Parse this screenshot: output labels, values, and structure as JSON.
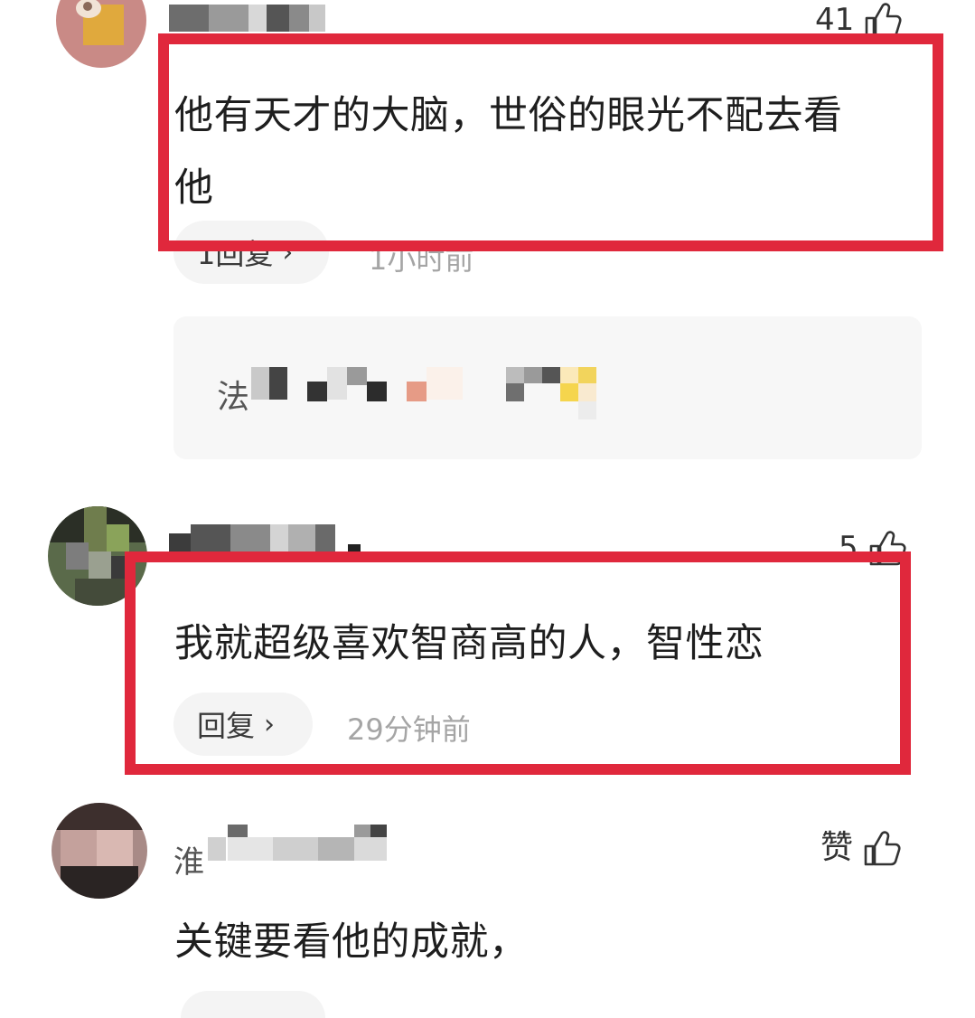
{
  "colors": {
    "highlight": "#e0283c",
    "meta_text": "#a5a5a5",
    "pill_bg": "#f4f4f4",
    "subreply_bg": "#f7f7f7"
  },
  "comments": [
    {
      "likes": "41",
      "like_icon": "thumb-up-icon",
      "text_line1": "他有天才的大脑，世俗的眼光不配去看",
      "text_line2": "他",
      "reply_label": "1回复",
      "time": "1小时前",
      "sub_reply_preview": "法"
    },
    {
      "likes": "5",
      "like_icon": "thumb-up-icon",
      "text": "我就超级喜欢智商高的人，智性恋",
      "reply_label": "回复",
      "time": "29分钟前"
    },
    {
      "likes": "赞",
      "like_icon": "thumb-up-icon",
      "username_visible_fragment": "淮",
      "text": "关键要看他的成就，"
    }
  ]
}
